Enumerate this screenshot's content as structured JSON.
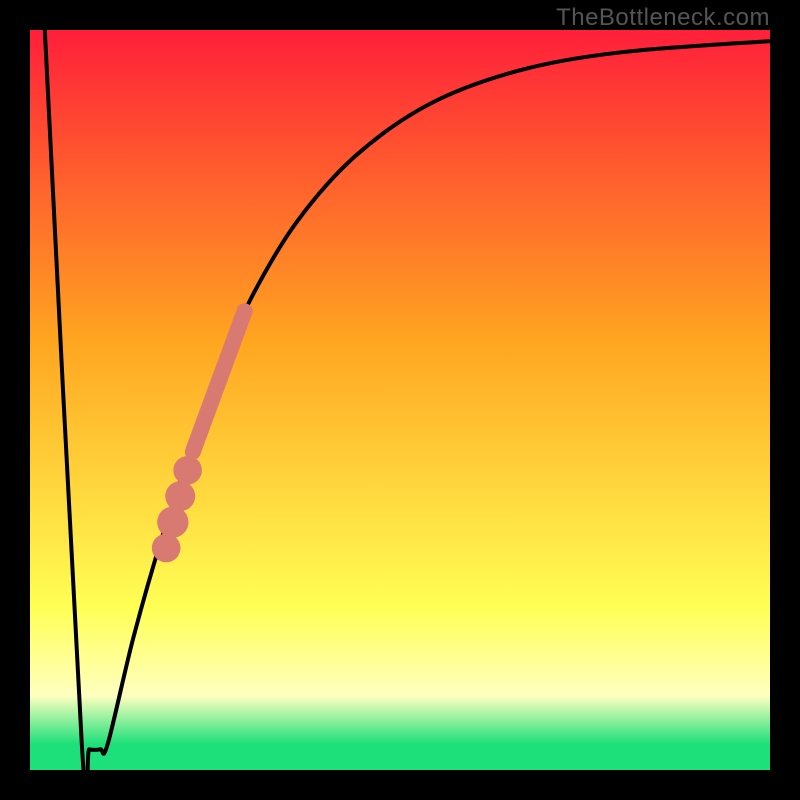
{
  "source_label": "TheBottleneck.com",
  "colors": {
    "red": "#ff1f3a",
    "orange": "#ffa520",
    "yellow": "#ffff55",
    "paleyellow": "#ffffc0",
    "green": "#1de07a",
    "curve": "#000000",
    "marker": "#d97a72",
    "frame": "#000000"
  },
  "chart_data": {
    "type": "line",
    "title": "",
    "xlabel": "",
    "ylabel": "",
    "xlim": [
      0,
      100
    ],
    "ylim": [
      0,
      100
    ],
    "gradient_stops": [
      {
        "offset": 0,
        "color_key": "red"
      },
      {
        "offset": 0.42,
        "color_key": "orange"
      },
      {
        "offset": 0.78,
        "color_key": "yellow"
      },
      {
        "offset": 0.9,
        "color_key": "paleyellow"
      },
      {
        "offset": 0.965,
        "color_key": "green"
      },
      {
        "offset": 1.0,
        "color_key": "green"
      }
    ],
    "series": [
      {
        "name": "bottleneck-curve",
        "points": [
          {
            "x": 2.0,
            "y": 100.0
          },
          {
            "x": 7.0,
            "y": 3.5
          },
          {
            "x": 8.0,
            "y": 2.8
          },
          {
            "x": 9.5,
            "y": 2.8
          },
          {
            "x": 10.5,
            "y": 3.5
          },
          {
            "x": 14.0,
            "y": 18.0
          },
          {
            "x": 18.0,
            "y": 32.0
          },
          {
            "x": 22.0,
            "y": 44.0
          },
          {
            "x": 26.0,
            "y": 55.0
          },
          {
            "x": 30.0,
            "y": 64.0
          },
          {
            "x": 36.0,
            "y": 74.0
          },
          {
            "x": 44.0,
            "y": 83.0
          },
          {
            "x": 54.0,
            "y": 90.0
          },
          {
            "x": 66.0,
            "y": 94.5
          },
          {
            "x": 80.0,
            "y": 97.0
          },
          {
            "x": 100.0,
            "y": 98.5
          }
        ]
      }
    ],
    "marker_segment": {
      "comment": "highlighted region on ascending branch",
      "thick": {
        "x1": 22.0,
        "y1": 43.0,
        "x2": 29.0,
        "y2": 62.0
      },
      "dots": [
        {
          "x": 21.3,
          "y": 40.5,
          "r": 1.4
        },
        {
          "x": 20.3,
          "y": 37.0,
          "r": 1.5
        },
        {
          "x": 19.3,
          "y": 33.5,
          "r": 1.6
        },
        {
          "x": 18.4,
          "y": 30.0,
          "r": 1.4
        }
      ]
    }
  }
}
